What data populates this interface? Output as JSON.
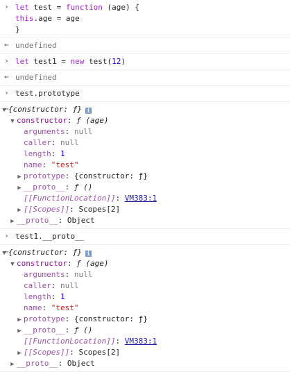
{
  "entries": [
    {
      "type": "input",
      "lines": [
        "let test = function (age) {",
        "this.age = age",
        "}"
      ]
    },
    {
      "type": "result",
      "text": "undefined"
    },
    {
      "type": "input",
      "lines": [
        "let test1 = new test(12)"
      ]
    },
    {
      "type": "result",
      "text": "undefined"
    }
  ],
  "inspect1": {
    "command": "test.prototype",
    "summary": "{constructor: ƒ}",
    "constructor_label": "constructor",
    "constructor_value": "ƒ (age)",
    "arguments_key": "arguments",
    "arguments_val": "null",
    "caller_key": "caller",
    "caller_val": "null",
    "length_key": "length",
    "length_val": "1",
    "name_key": "name",
    "name_val": "\"test\"",
    "prototype_key": "prototype",
    "prototype_val": "{constructor: ƒ}",
    "proto_key": "__proto__",
    "proto_val": "ƒ ()",
    "fnloc_key": "[[FunctionLocation]]",
    "fnloc_val": "VM383:1",
    "scopes_key": "[[Scopes]]",
    "scopes_val": "Scopes[2]",
    "outer_proto_key": "__proto__",
    "outer_proto_val": "Object"
  },
  "inspect2": {
    "command": "test1.__proto__",
    "summary": "{constructor: ƒ}",
    "constructor_label": "constructor",
    "constructor_value": "ƒ (age)",
    "arguments_key": "arguments",
    "arguments_val": "null",
    "caller_key": "caller",
    "caller_val": "null",
    "length_key": "length",
    "length_val": "1",
    "name_key": "name",
    "name_val": "\"test\"",
    "prototype_key": "prototype",
    "prototype_val": "{constructor: ƒ}",
    "proto_key": "__proto__",
    "proto_val": "ƒ ()",
    "fnloc_key": "[[FunctionLocation]]",
    "fnloc_val": "VM383:1",
    "scopes_key": "[[Scopes]]",
    "scopes_val": "Scopes[2]",
    "outer_proto_key": "__proto__",
    "outer_proto_val": "Object"
  },
  "icons": {
    "prompt": "chevron-right-icon",
    "result": "return-arrow-icon",
    "expanded": "triangle-down-icon",
    "collapsed": "triangle-right-icon",
    "info": "info-icon"
  }
}
